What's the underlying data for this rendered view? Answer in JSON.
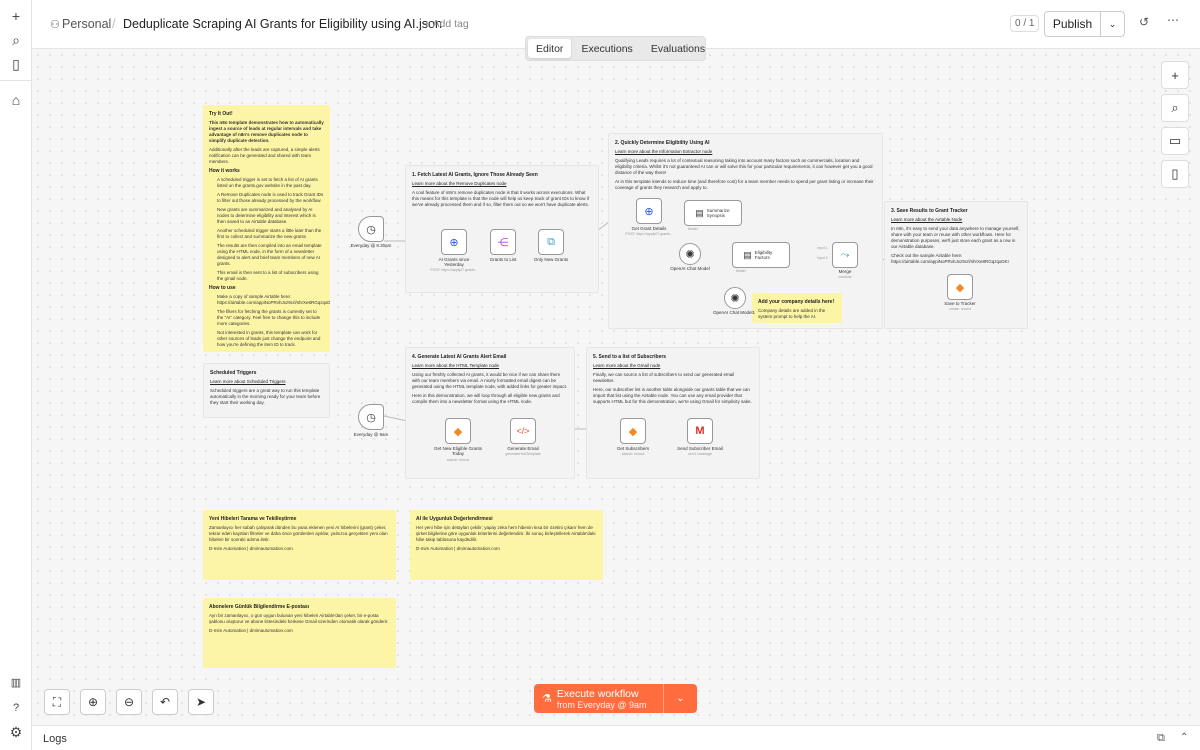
{
  "breadcrumb": {
    "workspace": "Personal",
    "separator": "/"
  },
  "workflow": {
    "title": "Deduplicate Scraping AI Grants for Eligibility using AI.json",
    "add_tag": "+ Add tag"
  },
  "header": {
    "counter": "0 / 1",
    "publish": "Publish"
  },
  "tabs": [
    {
      "label": "Editor"
    },
    {
      "label": "Executions"
    },
    {
      "label": "Evaluations"
    }
  ],
  "execute": {
    "label": "Execute workflow",
    "sub": "from Everyday @ 9am"
  },
  "logs": {
    "label": "Logs"
  },
  "notes": {
    "try": {
      "title": "Try It Out!",
      "p1": "This n8n template demonstrates how to automatically ingest a source of leads at regular intervals and take advantage of n8n's remove duplicates node to simplify duplicate detection.",
      "p2": "Additionally after the leads are captured, a simple alerts notification can be generated and shared with team members.",
      "h2": "How it works",
      "b1": "A scheduled trigger is set to fetch a list of AI grants listed on the grants.gov website in the past day.",
      "b2": "A Remove Duplicates node is used to track Grant IDs to filter out those already processed by the workflow.",
      "b3": "New grants are summarized and analysed by AI nodes to determine eligibility and interest which is then saved to an Airtable database.",
      "b4": "Another scheduled trigger starts a little later than the first to collect and summarize the new grants",
      "b5": "The results are then compiled into an email template using the HTML node, in the form of a newsletter designed to alert and brief team members of new AI grants.",
      "b6": "This email is then sent to a list of subscribers using the gmail node.",
      "h3": "How to use",
      "u1": "Make a copy of sample Airtable here: https://airtable.com/appiNoPRvhJxz9crl/shrXe8RGqzqxDKI",
      "u2": "The filters for fetching the grants is currently set to the \"AI\" category. Feel free to change this to include more categories.",
      "u3": "Not interested in grants, this template can work for other sources of leads just change the endpoint and how you're defining the item ID to track."
    },
    "sched": {
      "title": "Scheduled Triggers",
      "link": "Learn more about Scheduled Triggers",
      "body": "Scheduled triggers are a great way to run this template automatically in the morning ready for your team before they start their working day."
    },
    "s1": {
      "title": "1. Fetch Latest AI Grants, Ignore Those Already Seen",
      "link": "Learn more about the Remove Duplicates node",
      "body": "A cool feature of n8n's remove duplicates node is that it works across executions. What this means for this template is that the node will help us keep track of grant IDs to know if we've already processed them and if so, filter them out so we won't have duplicate alerts."
    },
    "s2": {
      "title": "2. Quickly Determine Eligibility Using AI",
      "link": "Learn more about the Information Extractor node",
      "p1": "Qualifying Leads requires a lot of contextual reasoning taking into account many factors such as commercials, location and eligibility criteria. Whilst it's not guaranteed AI can or will solve this for your particular requirements, it can however get you a good distance of the way there!",
      "p2": "AI in this template intends to reduce time (and therefore cost) for a team member needs to spend per grant listing or increase their coverage of grants they research and apply to."
    },
    "s3": {
      "title": "3. Save Results to Grant Tracker",
      "link": "Learn more about the Airtable Node",
      "p1": "In n8n, it's easy to send your data anywhere to manage yourself, share with your team or reuse with other workflows. Here for demonstration purposes, we'll just store each grant as a row in our Airtable database.",
      "p2": "Check out the sample Airtable here: https://airtable.com/appiNoPRvhJxz9crl/shrXe8RGqzqxDKI"
    },
    "s4": {
      "title": "4. Generate Latest AI Grants Alert Email",
      "link": "Learn more about the HTML Template node",
      "p1": "Using our freshly collected AI grants, it would be nice if we can share them with our team members via email. A nicely formatted email digest can be generated using the HTML template node, with added links for greater impact.",
      "p2": "Here in this demonstration, we will loop through all eligible new grants and compile them into a newsletter format using the HTML node."
    },
    "s5": {
      "title": "5. Send to a list of Subscribers",
      "link": "Learn more about the Gmail node",
      "p1": "Finally, we can source a list of subscribers to send our generated email newsletter.",
      "p2": "Here, our subscriber list is another table alongside our grants table that we can import that list using the Airtable node. You can use any email provider that supports HTML but for this demonstration, we're using Gmail for simplicity sake."
    },
    "company": {
      "title": "Add your company details here!",
      "body": "Company details are added in the system prompt to help the AI."
    },
    "tr1": {
      "title": "Yeni Hibeleri Tarama ve Tekilleştirme",
      "body": "Zamanlayıcı her sabah çalışarak dünden bu yana eklenen yeni AI hibelerini (grant) çeker, tekrar eden kayıtları filtreler ve daha önce görülenleri ayıklar, yalnızca gerçekten yeni olan hibeleri bir sonraki adıma iletir.",
      "sig": "D-mim Automation | dmimautomation.com"
    },
    "tr2": {
      "title": "AI ile Uygunluk Değerlendirmesi",
      "body": "Her yeni hibe için detayları çekilir; yapay zeka hem hibenin kısa bir özetini çıkarır hem de şirket bilgilerine göre uygunluk kriterlerini değerlendirir. İki sonuç birleştirilerek Airtable'daki hibe takip tablosuna kaydedilir.",
      "sig": "D-mim Automation | dmimautomation.com"
    },
    "tr3": {
      "title": "Abonelere Günlük Bilgilendirme E-postası",
      "body": "Ayrı bir zamanlayıcı, o gün uygun bulunan yeni hibeleri Airtable'dan çeker, bir e-posta şablonu oluşturur ve abone listesindeki herkese Gmail üzerinden otomatik olarak gönderir.",
      "sig": "D-mim Automation | dmimautomation.com"
    }
  },
  "nodes": {
    "t1": "Everyday @ 8.30am",
    "n1": "AI Grants since Yesterday",
    "n1s": "POST: https://apply07.grants...",
    "n2": "Grants to List",
    "n3": "Only New Grants",
    "n4": "Get Grant Details",
    "n4s": "POST: https://apply07.grants...",
    "n5": "Summarize Synopsis",
    "n6": "Eligibility Factors",
    "n7": "OpenAI Chat Model",
    "n8": "OpenAI Chat Model1",
    "n9": "Merge",
    "n9s": "combine",
    "n10": "Save to Tracker",
    "n10s": "create: record",
    "t2": "Everyday @ 9am",
    "n11": "Get New Eligible Grants Today",
    "n11s": "search: record",
    "n12": "Generate Email",
    "n12s": "generateHtmlTemplate",
    "n13": "Get Subscribers",
    "n13s": "search: record",
    "n14": "Send Subscriber Email",
    "n14s": "send: message",
    "p_model": "Model",
    "p_model2": "Model",
    "p_input1": "Input 1",
    "p_input2": "Input 2"
  },
  "colors": {
    "accent": "#ff6d3f",
    "note": "#fdf5a6"
  }
}
